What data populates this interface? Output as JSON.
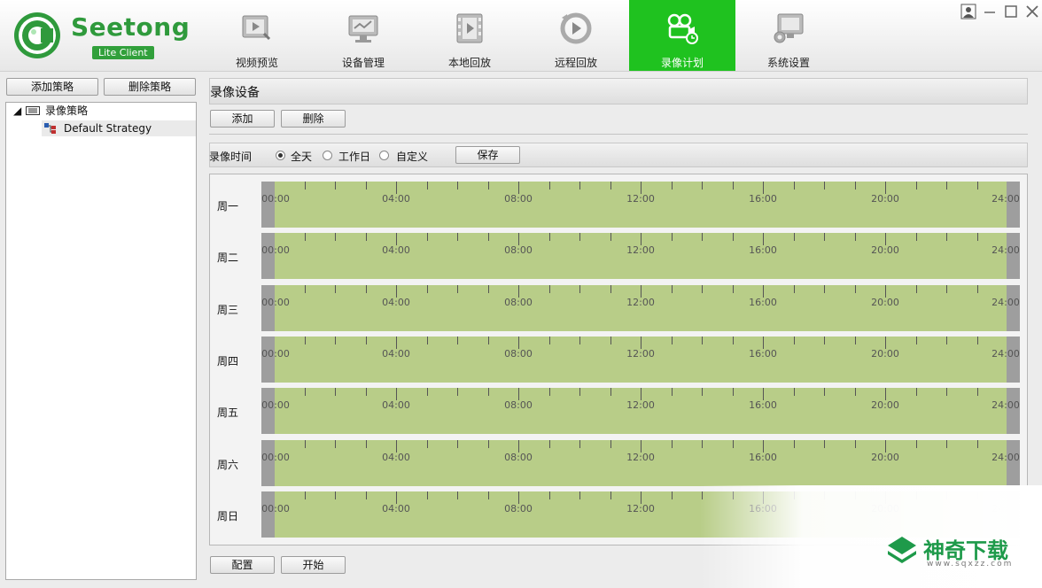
{
  "app": {
    "logo_name": "Seetong",
    "logo_badge": "Lite Client"
  },
  "nav": [
    {
      "label": "视频预览",
      "icon": "video-preview-icon"
    },
    {
      "label": "设备管理",
      "icon": "device-manage-icon"
    },
    {
      "label": "本地回放",
      "icon": "local-playback-icon"
    },
    {
      "label": "远程回放",
      "icon": "remote-playback-icon"
    },
    {
      "label": "录像计划",
      "icon": "record-plan-icon",
      "active": true
    },
    {
      "label": "系统设置",
      "icon": "settings-icon"
    }
  ],
  "left": {
    "add_label": "添加策略",
    "delete_label": "删除策略",
    "tree_root": "录像策略",
    "tree_child": "Default Strategy"
  },
  "device": {
    "title": "录像设备",
    "add_label": "添加",
    "delete_label": "删除"
  },
  "record_time": {
    "label": "录像时间",
    "options": [
      "全天",
      "工作日",
      "自定义"
    ],
    "selected": "全天",
    "save_label": "保存"
  },
  "schedule": {
    "days": [
      "周一",
      "周二",
      "周三",
      "周四",
      "周五",
      "周六",
      "周日"
    ],
    "hour_labels": [
      "00:00",
      "04:00",
      "08:00",
      "12:00",
      "16:00",
      "20:00",
      "24:00"
    ],
    "bar_color": "#b8cd88",
    "cap_color": "#9e9e9e"
  },
  "bottom": {
    "config_label": "配置",
    "start_label": "开始"
  },
  "watermark": {
    "name": "神奇下载",
    "url": "www.sqxzz.com"
  },
  "colors": {
    "accent": "#1fc21f",
    "brand": "#2f9a3c"
  }
}
